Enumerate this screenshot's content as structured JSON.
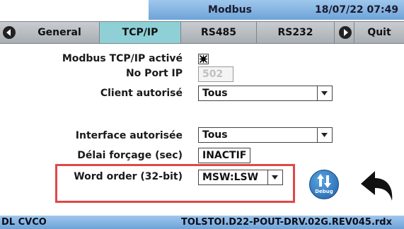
{
  "titlebar": {
    "title": "Modbus",
    "datetime": "18/07/22 07:49"
  },
  "tabs": {
    "general": "General",
    "tcpip": "TCP/IP",
    "rs485": "RS485",
    "rs232": "RS232",
    "quit": "Quit",
    "active": "TCP/IP"
  },
  "form": {
    "modbus_tcp_label": "Modbus TCP/IP activé",
    "modbus_tcp_checked": true,
    "port_label": "No Port IP",
    "port_value": "502",
    "client_label": "Client autorisé",
    "client_value": "Tous",
    "interface_label": "Interface autorisée",
    "interface_value": "Tous",
    "delay_label": "Délai forçage (sec)",
    "delay_value": "INACTIF",
    "word_order_label": "Word order (32-bit)",
    "word_order_value": "MSW:LSW"
  },
  "buttons": {
    "debug_label": "Debug"
  },
  "statusbar": {
    "left": "DL CVCO",
    "right": "TOLSTOI.D22-POUT-DRV.02G.REV045.rdx"
  },
  "colors": {
    "accent": "#6ea3d8",
    "active_tab": "#8fd0d6",
    "highlight": "#e04848"
  }
}
